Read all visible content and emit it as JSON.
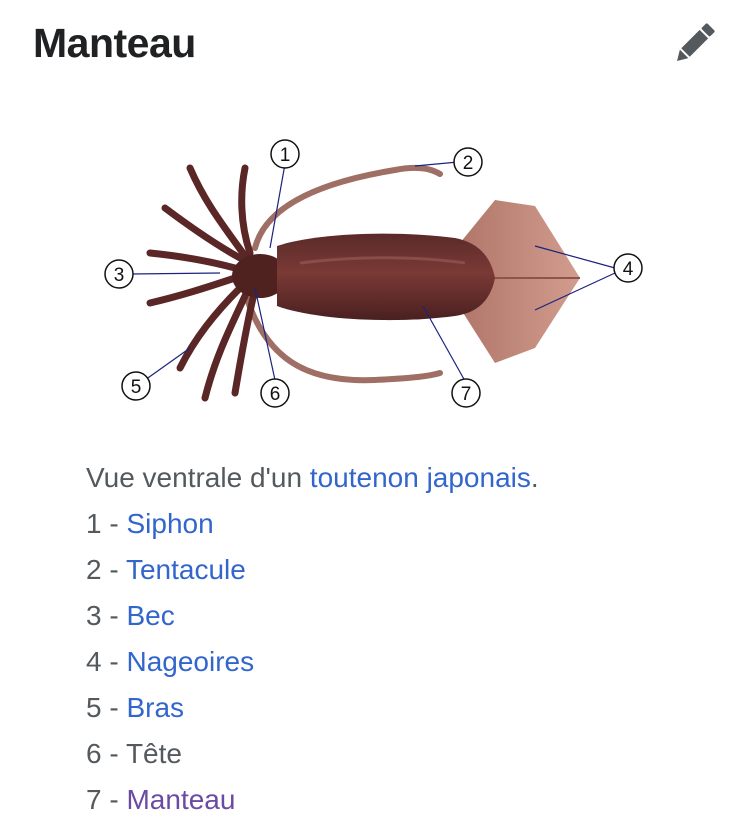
{
  "header": {
    "title": "Manteau",
    "edit_icon": "pencil-icon"
  },
  "figure": {
    "callouts": [
      "1",
      "2",
      "3",
      "4",
      "5",
      "6",
      "7"
    ]
  },
  "caption": {
    "intro_prefix": "Vue ventrale d'un ",
    "intro_link": "toutenon japonais",
    "intro_suffix": ".",
    "items": [
      {
        "num": "1 - ",
        "label": "Siphon",
        "link": true
      },
      {
        "num": "2 - ",
        "label": "Tentacule",
        "link": true
      },
      {
        "num": "3 - ",
        "label": "Bec",
        "link": true
      },
      {
        "num": "4 - ",
        "label": "Nageoires",
        "link": true
      },
      {
        "num": "5 - ",
        "label": "Bras",
        "link": true
      },
      {
        "num": "6 - ",
        "label": "Tête",
        "link": false
      },
      {
        "num": "7 - ",
        "label": "Manteau",
        "link": true,
        "visited": true
      }
    ]
  },
  "colors": {
    "link": "#3366cc",
    "visited_link": "#6b4ba1",
    "text": "#54595d",
    "title": "#202122"
  }
}
